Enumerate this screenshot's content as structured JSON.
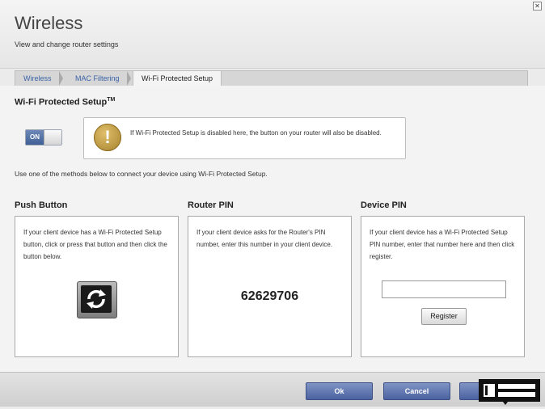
{
  "header": {
    "title": "Wireless",
    "subtitle": "View and change router settings",
    "close_glyph": "✕"
  },
  "tabs": [
    {
      "label": "Wireless",
      "active": false
    },
    {
      "label": "MAC Filtering",
      "active": false
    },
    {
      "label": "Wi-Fi Protected Setup",
      "active": true
    }
  ],
  "wps": {
    "section_title": "Wi-Fi Protected Setup",
    "section_title_sup": "TM",
    "toggle_label": "ON",
    "toggle_state": "on",
    "info_icon": "warning-icon",
    "info_icon_glyph": "!",
    "info_text": "If Wi-Fi Protected Setup is disabled here, the button on your router will also be disabled.",
    "instructions": "Use one of the methods below to connect your device using Wi-Fi Protected Setup."
  },
  "methods": {
    "push": {
      "title": "Push Button",
      "text": "If your client device has a Wi-Fi Protected Setup button, click or press that button and then click the button below.",
      "icon": "wps-icon"
    },
    "router_pin": {
      "title": "Router PIN",
      "text": "If your client device asks for the Router's PIN number, enter this number in your client device.",
      "pin": "62629706"
    },
    "device_pin": {
      "title": "Device PIN",
      "text": "If your client device has a Wi-Fi Protected Setup PIN number, enter that number here and then click register.",
      "input_value": "",
      "register_label": "Register"
    }
  },
  "footer": {
    "ok_label": "Ok",
    "cancel_label": "Cancel",
    "apply_label": ""
  },
  "colors": {
    "accent": "#4b62a0",
    "tab_link": "#3a63a8",
    "warning": "#b8913a"
  }
}
